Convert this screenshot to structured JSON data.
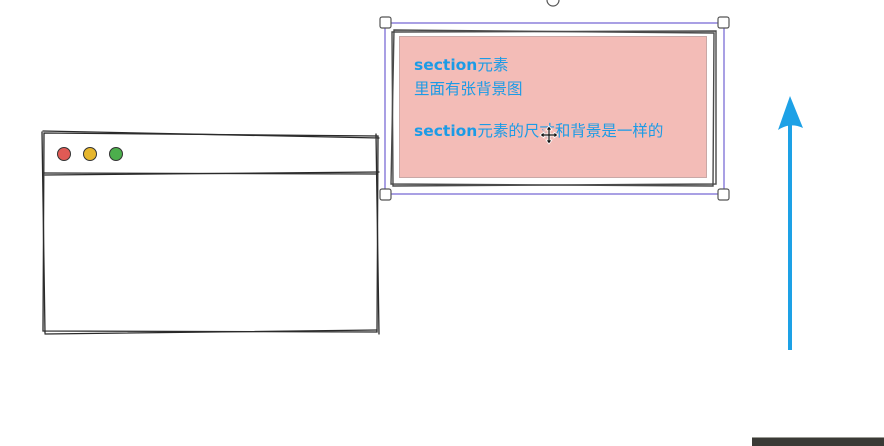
{
  "note": {
    "line1_bold": "section",
    "line1_rest": "元素",
    "line2": "里面有张背景图",
    "line3_bold": "section",
    "line3_rest": "元素的尺寸和背景是一样的"
  },
  "browser_window": {
    "traffic_lights": [
      "#e05a55",
      "#e6b62d",
      "#4cae4c"
    ]
  },
  "colors": {
    "arrow": "#1da1e6",
    "note_fill": "#f3bcb7",
    "note_text": "#1c9be6",
    "selection": "#7b6cd6"
  },
  "icons": [
    "move-cursor-icon",
    "up-arrow-icon",
    "rotate-handle-icon"
  ]
}
